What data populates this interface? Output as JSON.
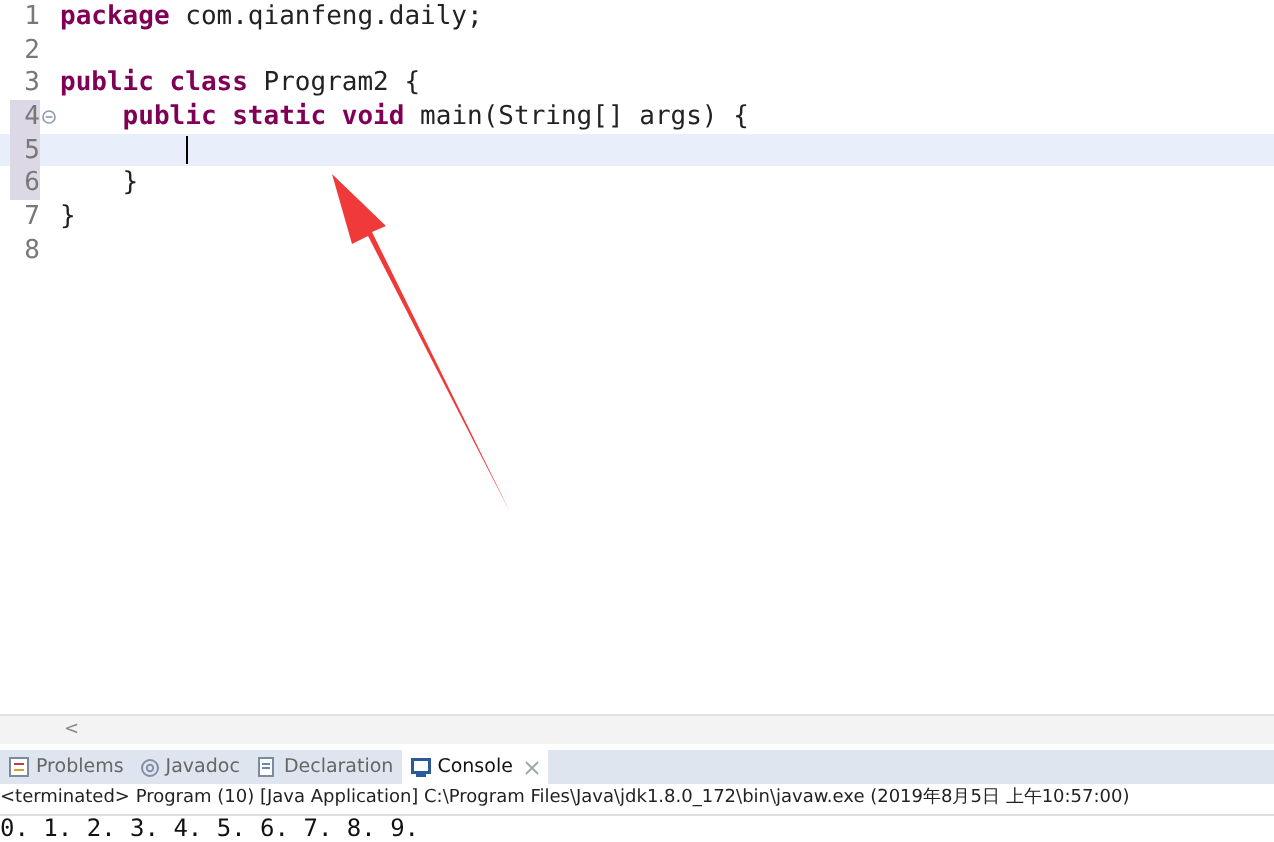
{
  "editor": {
    "lines": [
      {
        "number": "1",
        "current": false,
        "marked": false,
        "fold": false,
        "tokens": [
          {
            "kind": "keyword",
            "text": "package"
          },
          {
            "kind": "plain",
            "text": " com.qianfeng.daily;"
          }
        ]
      },
      {
        "number": "2",
        "current": false,
        "marked": false,
        "fold": false
      },
      {
        "number": "3",
        "current": false,
        "marked": false,
        "fold": false,
        "tokens": [
          {
            "kind": "keyword",
            "text": "public"
          },
          {
            "kind": "keyword",
            "text": " class"
          },
          {
            "kind": "plain",
            "text": " Program2 {"
          }
        ]
      },
      {
        "number": "4",
        "current": false,
        "marked": true,
        "fold": true,
        "tokens": [
          {
            "kind": "keyword",
            "text": "    public"
          },
          {
            "kind": "keyword",
            "text": " static"
          },
          {
            "kind": "keyword",
            "text": " void"
          },
          {
            "kind": "plain",
            "text": " main(String[] args) {"
          }
        ]
      },
      {
        "number": "5",
        "current": true,
        "marked": true,
        "fold": false
      },
      {
        "number": "6",
        "current": false,
        "marked": true,
        "fold": false,
        "tokens": [
          {
            "kind": "plain",
            "text": "    }"
          }
        ]
      },
      {
        "number": "7",
        "current": false,
        "marked": false,
        "fold": false,
        "tokens": [
          {
            "kind": "plain",
            "text": "}"
          }
        ]
      },
      {
        "number": "8",
        "current": false,
        "marked": false,
        "fold": false
      }
    ]
  },
  "scrollbar": {
    "arrow": "<"
  },
  "panel": {
    "tabs": [
      {
        "label": "Problems",
        "kind": "problems",
        "selected": false
      },
      {
        "label": "Javadoc",
        "kind": "javadoc",
        "selected": false
      },
      {
        "label": "Declaration",
        "kind": "declaration",
        "selected": false
      },
      {
        "label": "Console",
        "kind": "console",
        "selected": true
      }
    ],
    "header": "<terminated> Program (10) [Java Application] C:\\Program Files\\Java\\jdk1.8.0_172\\bin\\javaw.exe (2019年8月5日 上午10:57:00)",
    "output": "0. 1. 2. 3. 4. 5. 6. 7. 8. 9."
  }
}
